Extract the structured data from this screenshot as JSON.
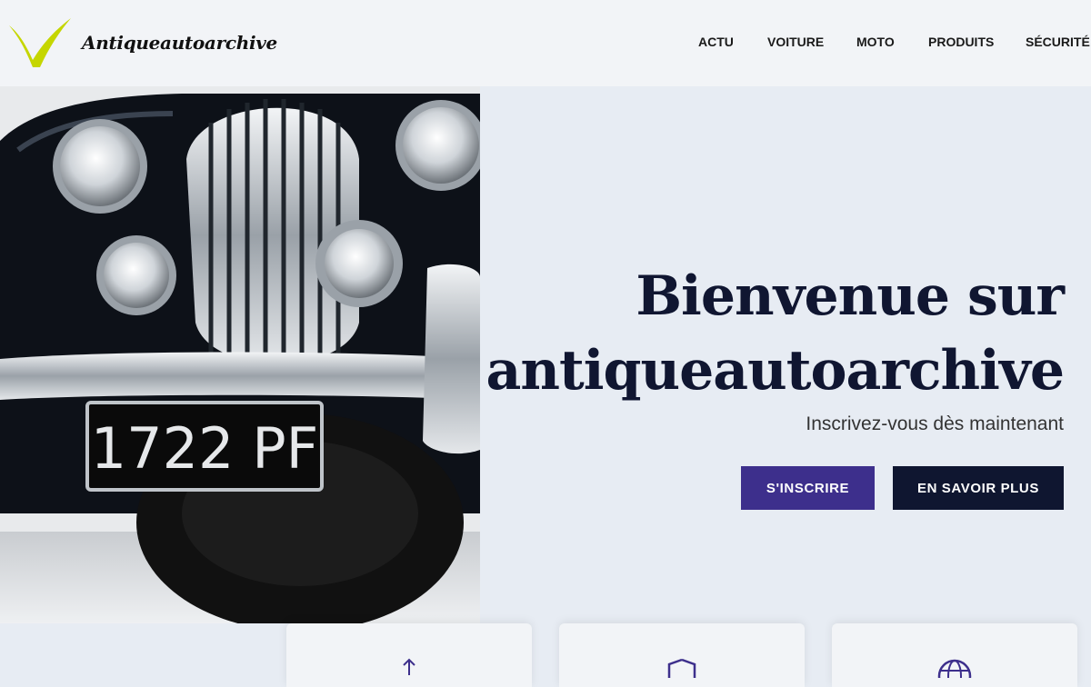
{
  "brand": {
    "name": "Antiqueautoarchive",
    "logo": "checkmark-logo-icon",
    "accent": "#c5d600"
  },
  "nav": {
    "items": [
      "ACTU",
      "VOITURE",
      "MOTO",
      "PRODUITS",
      "SÉCURITÉ"
    ]
  },
  "hero": {
    "title_line1": "Bienvenue sur",
    "title_line2": "antiqueautoarchive",
    "subtitle": "Inscrivez-vous dès maintenant",
    "image": {
      "subject": "classic-car-front",
      "plate": "1722 PF"
    },
    "buttons": {
      "primary": "S'INSCRIRE",
      "secondary": "EN SAVOIR PLUS"
    }
  },
  "feature_cards": [
    {
      "icon": "arrow-up-icon"
    },
    {
      "icon": "shield-icon"
    },
    {
      "icon": "globe-icon"
    }
  ],
  "colors": {
    "primary": "#3d2f8c",
    "dark": "#0f1630",
    "page_bg": "#e7ecf3",
    "header_bg": "#f2f4f7"
  }
}
